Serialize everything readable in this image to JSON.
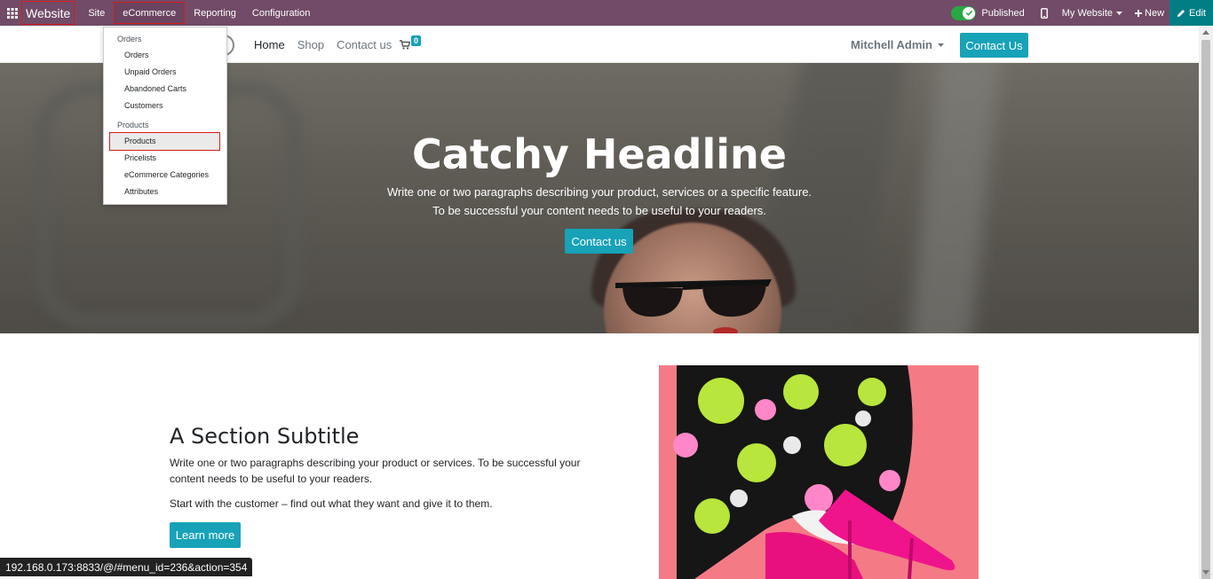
{
  "topbar": {
    "app_name": "Website",
    "menus": [
      "Site",
      "eCommerce",
      "Reporting",
      "Configuration"
    ],
    "published_label": "Published",
    "my_website_label": "My Website",
    "new_label": "New",
    "edit_label": "Edit",
    "colors": {
      "bar": "#714b67",
      "toggle": "#28a745",
      "edit": "#017e84"
    }
  },
  "dropdown": {
    "groups": [
      {
        "header": "Orders",
        "items": [
          "Orders",
          "Unpaid Orders",
          "Abandoned Carts",
          "Customers"
        ]
      },
      {
        "header": "Products",
        "items": [
          "Products",
          "Pricelists",
          "eCommerce Categories",
          "Attributes"
        ]
      }
    ],
    "selected": "Products"
  },
  "header": {
    "nav": [
      "Home",
      "Shop",
      "Contact us"
    ],
    "cart_count": "0",
    "user": "Mitchell Admin",
    "contact_button": "Contact Us",
    "accent": "#17a2b8"
  },
  "hero": {
    "title": "Catchy Headline",
    "line1": "Write one or two paragraphs describing your product, services or a specific feature.",
    "line2": "To be successful your content needs to be useful to your readers.",
    "cta": "Contact us"
  },
  "section": {
    "title": "A Section Subtitle",
    "text1": "Write one or two paragraphs describing your product or services. To be successful your content needs to be useful to your readers.",
    "text2": "Start with the customer – find out what they want and give it to them.",
    "button": "Learn more"
  },
  "status_url": "192.168.0.173:8833/@/#menu_id=236&action=354"
}
